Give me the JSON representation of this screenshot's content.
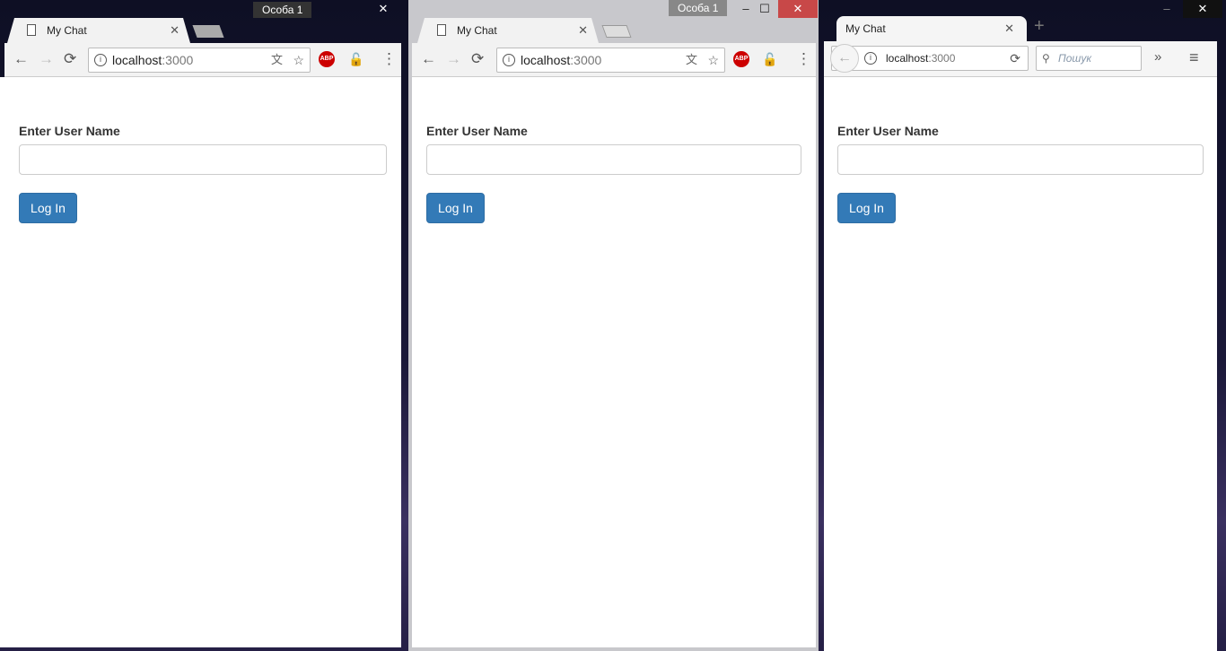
{
  "windows": [
    {
      "browser": "Chrome",
      "profile": "Особа 1",
      "tab_title": "My Chat",
      "url_host": "localhost",
      "url_port": ":3000",
      "label": "Enter User Name",
      "input_value": "",
      "button": "Log In"
    },
    {
      "browser": "Chrome",
      "profile": "Особа 1",
      "tab_title": "My Chat",
      "url_host": "localhost",
      "url_port": ":3000",
      "label": "Enter User Name",
      "input_value": "",
      "button": "Log In"
    },
    {
      "browser": "Firefox",
      "tab_title": "My Chat",
      "url_host": "localhost",
      "url_port": ":3000",
      "search_placeholder": "Пошук",
      "label": "Enter User Name",
      "input_value": "",
      "button": "Log In"
    }
  ],
  "icons": {
    "abp": "ABP",
    "close": "✕",
    "min": "–",
    "max": "☐"
  },
  "colors": {
    "primary": "#337ab7",
    "close_red": "#c84848"
  }
}
